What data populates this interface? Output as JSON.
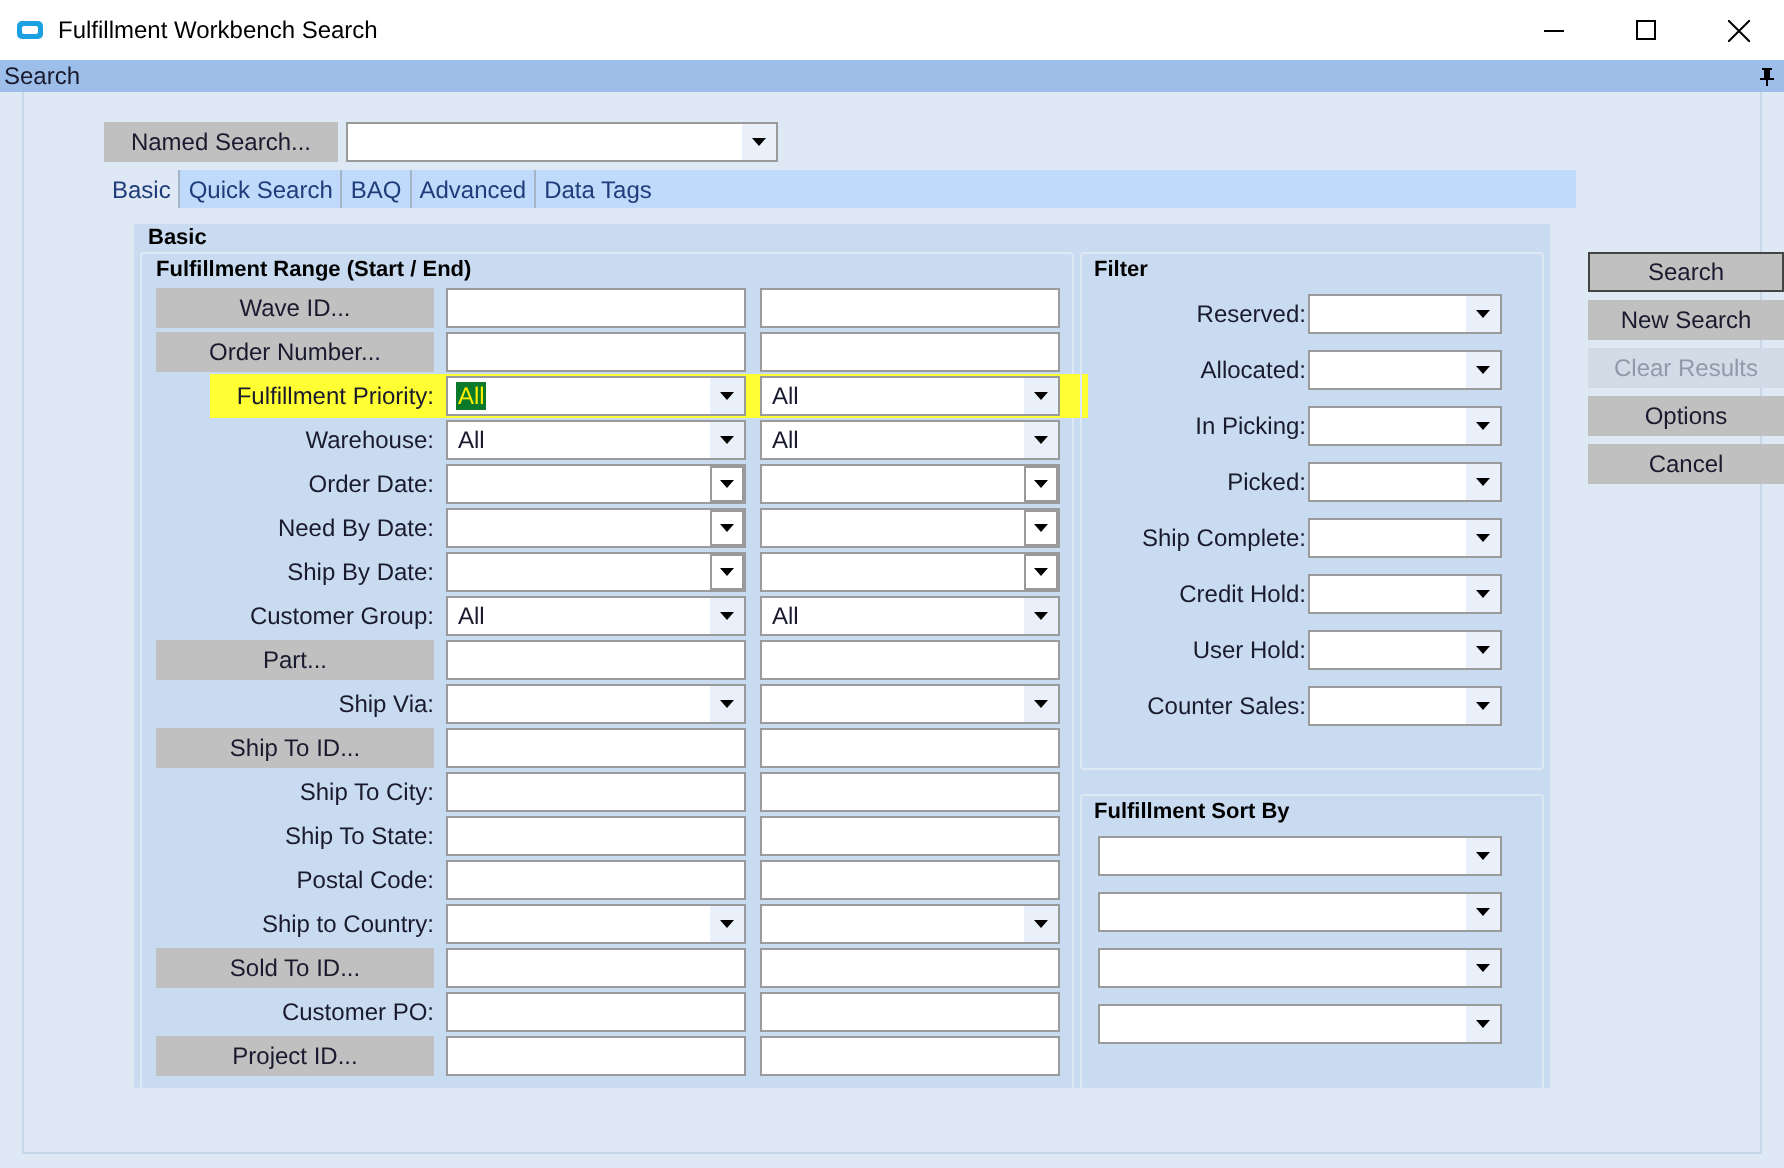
{
  "window": {
    "title": "Fulfillment Workbench Search"
  },
  "panel_header": {
    "title": "Search"
  },
  "named_search": {
    "button": "Named Search..."
  },
  "tabs": [
    {
      "label": "Basic",
      "selected": true
    },
    {
      "label": "Quick Search",
      "selected": false
    },
    {
      "label": "BAQ",
      "selected": false
    },
    {
      "label": "Advanced",
      "selected": false
    },
    {
      "label": "Data Tags",
      "selected": false
    }
  ],
  "group_title": "Basic",
  "range": {
    "title": "Fulfillment Range (Start / End)",
    "rows": [
      {
        "label": {
          "text": "Wave ID...",
          "kind": "button"
        },
        "field": {
          "kind": "text"
        },
        "highlighted": false
      },
      {
        "label": {
          "text": "Order Number...",
          "kind": "button"
        },
        "field": {
          "kind": "text"
        },
        "highlighted": false
      },
      {
        "label": {
          "text": "Fulfillment Priority:",
          "kind": "label"
        },
        "field": {
          "kind": "combo",
          "start": "All",
          "end": "All",
          "start_selected": true
        },
        "highlighted": true
      },
      {
        "label": {
          "text": "Warehouse:",
          "kind": "label"
        },
        "field": {
          "kind": "combo",
          "start": "All",
          "end": "All",
          "start_selected": false
        },
        "highlighted": false
      },
      {
        "label": {
          "text": "Order Date:",
          "kind": "label"
        },
        "field": {
          "kind": "date"
        },
        "highlighted": false
      },
      {
        "label": {
          "text": "Need By Date:",
          "kind": "label"
        },
        "field": {
          "kind": "date"
        },
        "highlighted": false
      },
      {
        "label": {
          "text": "Ship By Date:",
          "kind": "label"
        },
        "field": {
          "kind": "date"
        },
        "highlighted": false
      },
      {
        "label": {
          "text": "Customer Group:",
          "kind": "label"
        },
        "field": {
          "kind": "combo",
          "start": "All",
          "end": "All",
          "start_selected": false
        },
        "highlighted": false
      },
      {
        "label": {
          "text": "Part...",
          "kind": "button"
        },
        "field": {
          "kind": "text"
        },
        "highlighted": false
      },
      {
        "label": {
          "text": "Ship Via:",
          "kind": "label"
        },
        "field": {
          "kind": "combo"
        },
        "highlighted": false
      },
      {
        "label": {
          "text": "Ship To ID...",
          "kind": "button"
        },
        "field": {
          "kind": "text"
        },
        "highlighted": false
      },
      {
        "label": {
          "text": "Ship To City:",
          "kind": "label"
        },
        "field": {
          "kind": "text"
        },
        "highlighted": false
      },
      {
        "label": {
          "text": "Ship To State:",
          "kind": "label"
        },
        "field": {
          "kind": "text"
        },
        "highlighted": false
      },
      {
        "label": {
          "text": "Postal Code:",
          "kind": "label"
        },
        "field": {
          "kind": "text"
        },
        "highlighted": false
      },
      {
        "label": {
          "text": "Ship to Country:",
          "kind": "label"
        },
        "field": {
          "kind": "combo"
        },
        "highlighted": false
      },
      {
        "label": {
          "text": "Sold To ID...",
          "kind": "button"
        },
        "field": {
          "kind": "text"
        },
        "highlighted": false
      },
      {
        "label": {
          "text": "Customer PO:",
          "kind": "label"
        },
        "field": {
          "kind": "text"
        },
        "highlighted": false
      },
      {
        "label": {
          "text": "Project ID...",
          "kind": "button"
        },
        "field": {
          "kind": "text"
        },
        "highlighted": false
      }
    ]
  },
  "filter": {
    "title": "Filter",
    "rows": [
      {
        "label": "Reserved:"
      },
      {
        "label": "Allocated:"
      },
      {
        "label": "In Picking:"
      },
      {
        "label": "Picked:"
      },
      {
        "label": "Ship Complete:"
      },
      {
        "label": "Credit Hold:"
      },
      {
        "label": "User Hold:"
      },
      {
        "label": "Counter Sales:"
      }
    ]
  },
  "sort": {
    "title": "Fulfillment Sort By",
    "fields": [
      {
        "kind": "combo"
      },
      {
        "kind": "combo"
      },
      {
        "kind": "combo"
      },
      {
        "kind": "combo"
      }
    ]
  },
  "actions": [
    {
      "label": "Search",
      "default": true,
      "disabled": false
    },
    {
      "label": "New Search",
      "default": false,
      "disabled": false
    },
    {
      "label": "Clear Results",
      "default": false,
      "disabled": true
    },
    {
      "label": "Options",
      "default": false,
      "disabled": false
    },
    {
      "label": "Cancel",
      "default": false,
      "disabled": false
    }
  ]
}
